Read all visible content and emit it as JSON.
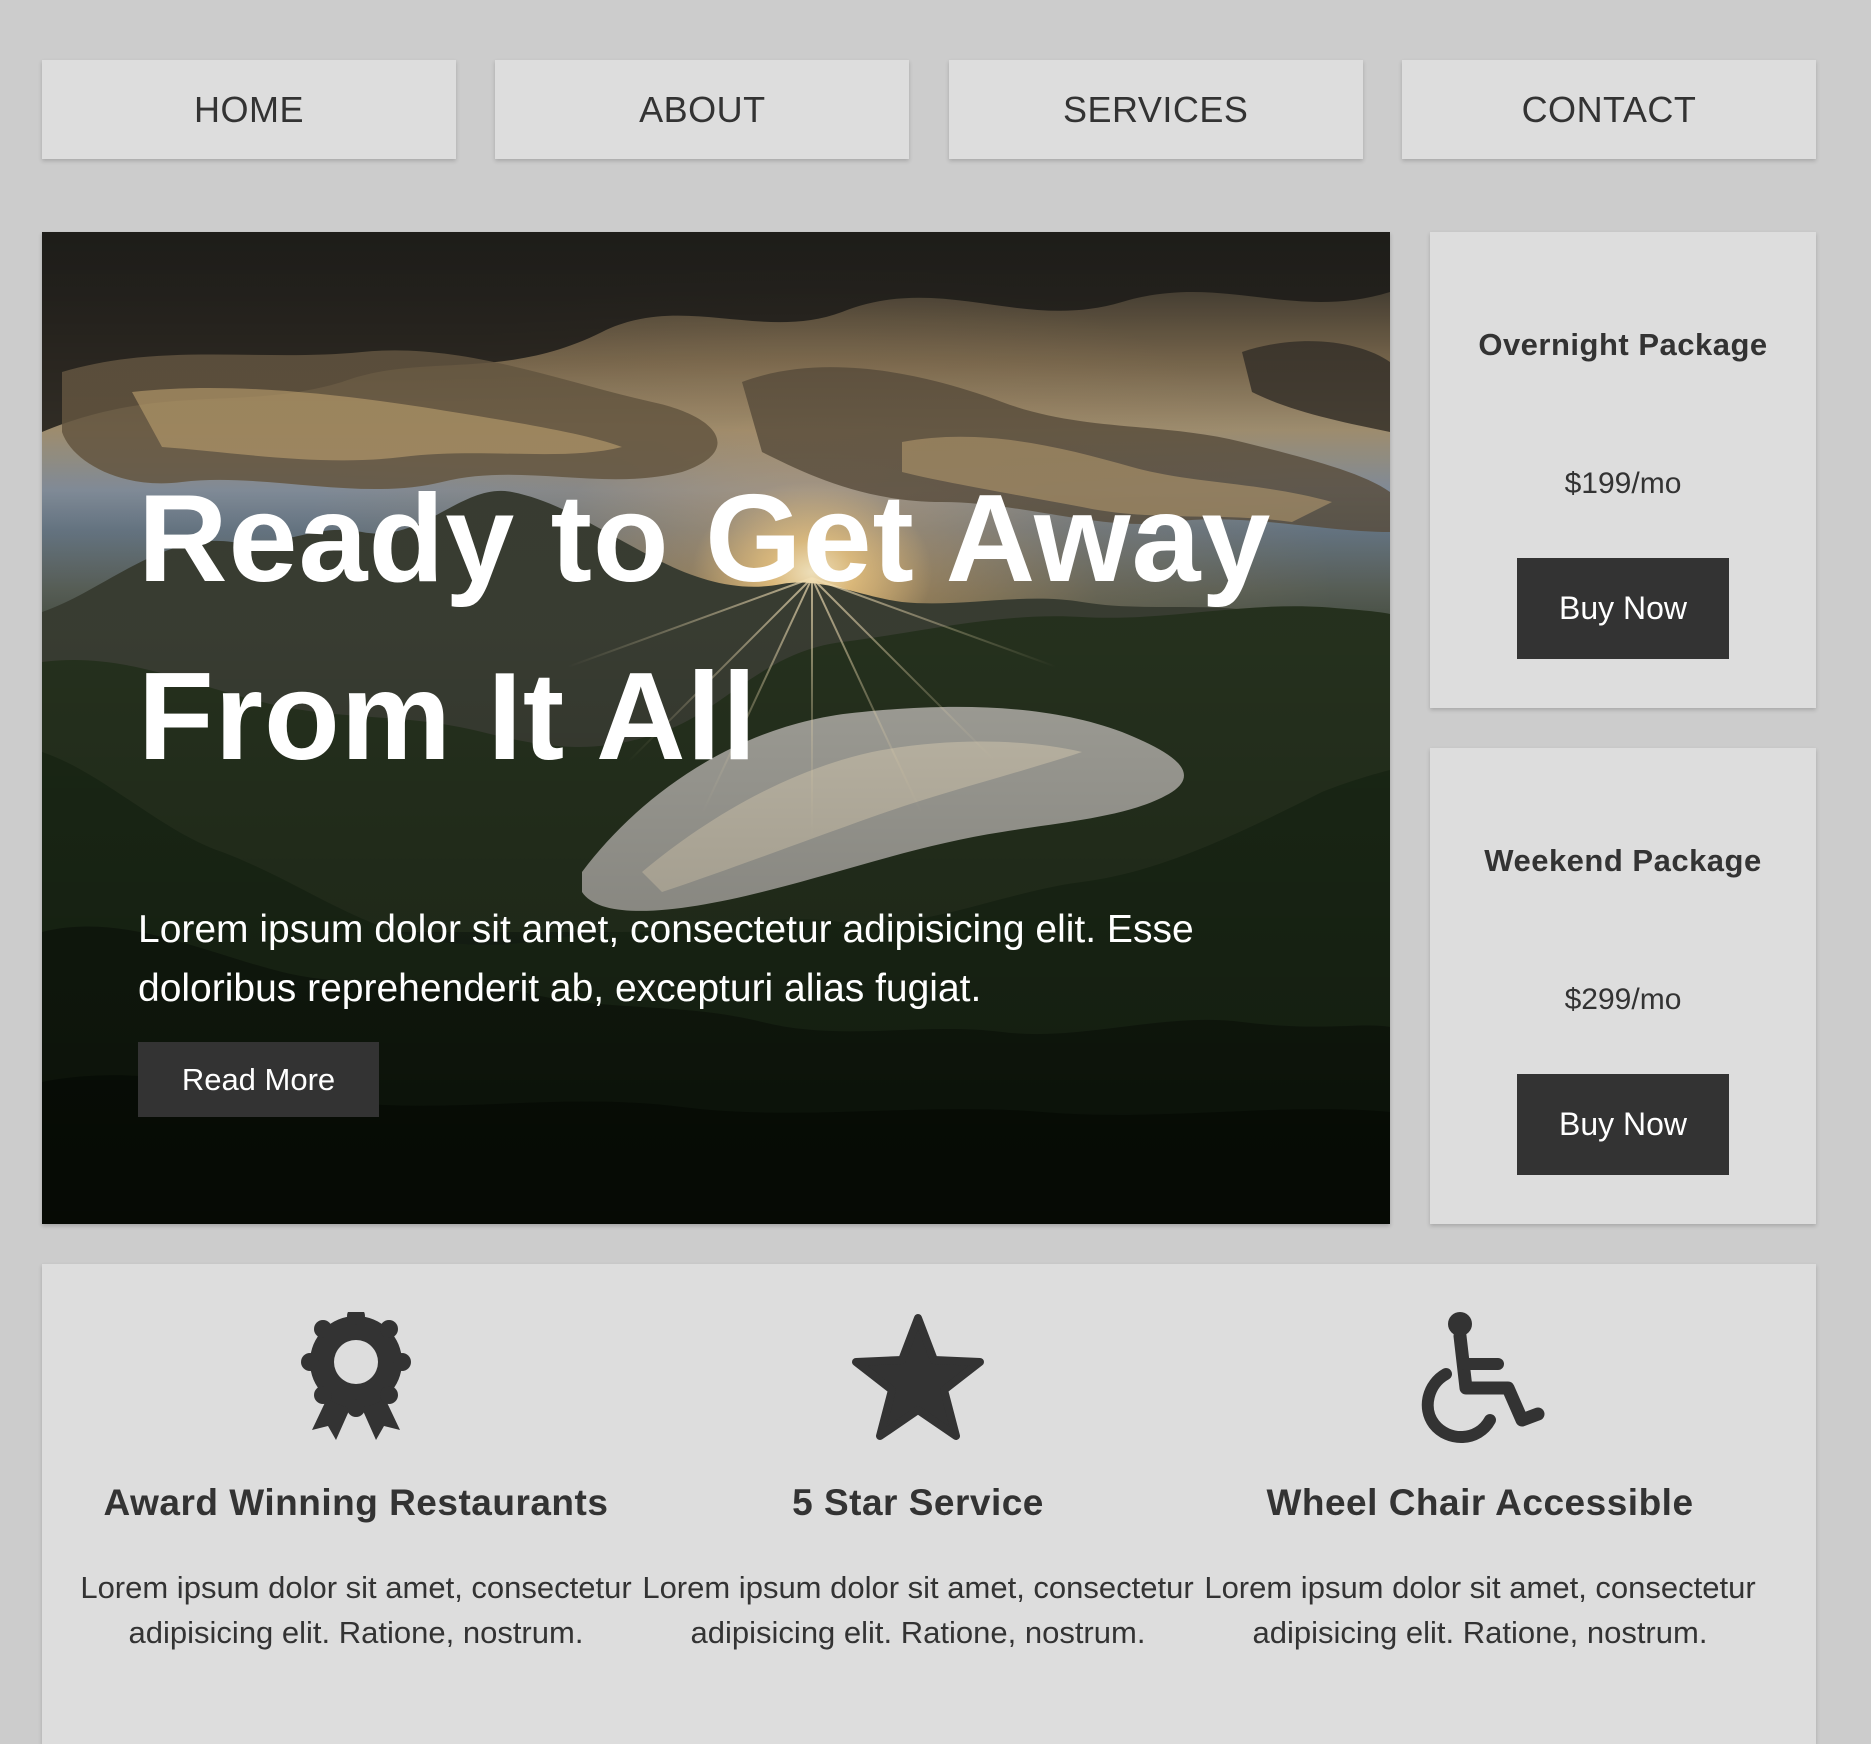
{
  "nav": {
    "items": [
      {
        "label": "HOME"
      },
      {
        "label": "ABOUT"
      },
      {
        "label": "SERVICES"
      },
      {
        "label": "CONTACT"
      }
    ]
  },
  "hero": {
    "title_line1": "Ready to Get Away",
    "title_line2": "From It All",
    "text": "Lorem ipsum dolor sit amet, consectetur adipisicing elit. Esse doloribus reprehenderit ab, excepturi alias fugiat.",
    "button_label": "Read More",
    "background_image": "sunset-over-mountain-lake"
  },
  "packages": [
    {
      "title": "Overnight Package",
      "price": "$199/mo",
      "button_label": "Buy Now"
    },
    {
      "title": "Weekend Package",
      "price": "$299/mo",
      "button_label": "Buy Now"
    }
  ],
  "features": [
    {
      "icon": "award-ribbon-icon",
      "title": "Award Winning Restaurants",
      "text": "Lorem ipsum dolor sit amet, consectetur adipisicing elit. Ratione, nostrum."
    },
    {
      "icon": "star-icon",
      "title": "5 Star Service",
      "text": "Lorem ipsum dolor sit amet, consectetur adipisicing elit. Ratione, nostrum."
    },
    {
      "icon": "wheelchair-icon",
      "title": "Wheel Chair Accessible",
      "text": "Lorem ipsum dolor sit amet, consectetur adipisicing elit. Ratione, nostrum."
    }
  ],
  "colors": {
    "page_background": "#cccccc",
    "panel_background": "#dddddd",
    "button_background": "#333333",
    "text": "#333333",
    "button_text": "#ffffff"
  }
}
